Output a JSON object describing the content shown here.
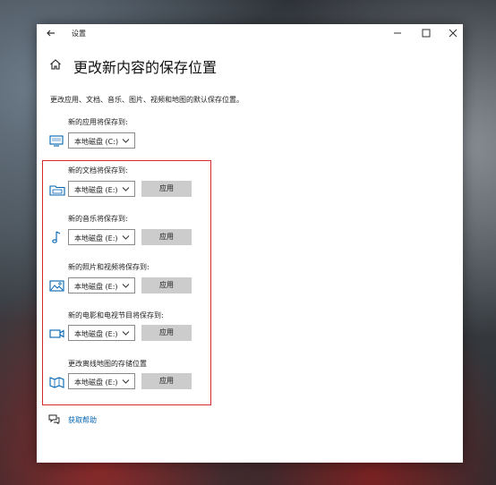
{
  "window": {
    "title": "设置",
    "controls": {
      "minimize": "minimize-icon",
      "maximize": "maximize-icon",
      "close": "close-icon"
    }
  },
  "page": {
    "title": "更改新内容的保存位置",
    "description": "更改应用、文档、音乐、图片、视频和地图的默认保存位置。"
  },
  "sections": [
    {
      "label": "新的应用将保存到:",
      "icon": "monitor-icon",
      "drive": "本地磁盘 (C:)",
      "apply": ""
    },
    {
      "label": "新的文档将保存到:",
      "icon": "document-drive-icon",
      "drive": "本地磁盘 (E:)",
      "apply": "应用"
    },
    {
      "label": "新的音乐将保存到:",
      "icon": "music-note-icon",
      "drive": "本地磁盘 (E:)",
      "apply": "应用"
    },
    {
      "label": "新的照片和视频将保存到:",
      "icon": "photo-icon",
      "drive": "本地磁盘 (E:)",
      "apply": "应用"
    },
    {
      "label": "新的电影和电视节目将保存到:",
      "icon": "video-icon",
      "drive": "本地磁盘 (E:)",
      "apply": "应用"
    },
    {
      "label": "更改离线地图的存储位置",
      "icon": "map-icon",
      "drive": "本地磁盘 (E:)",
      "apply": "应用"
    }
  ],
  "help": {
    "label": "获取帮助",
    "icon": "chat-help-icon"
  },
  "colors": {
    "accent": "#0063b1",
    "highlight_border": "#d42a2a",
    "button_bg": "#cccccc"
  }
}
